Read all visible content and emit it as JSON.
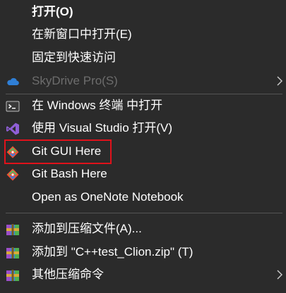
{
  "menu": {
    "items": [
      {
        "label": "打开(O)"
      },
      {
        "label": "在新窗口中打开(E)"
      },
      {
        "label": "固定到快速访问"
      },
      {
        "label": "SkyDrive Pro(S)",
        "icon": "cloud-icon",
        "disabled": true,
        "submenu": true
      },
      {
        "label": "在 Windows 终端 中打开",
        "icon": "terminal-icon"
      },
      {
        "label": "使用 Visual Studio 打开(V)",
        "icon": "visual-studio-icon"
      },
      {
        "label": "Git GUI Here",
        "icon": "git-icon",
        "highlighted": true
      },
      {
        "label": "Git Bash Here",
        "icon": "git-icon"
      },
      {
        "label": "Open as OneNote Notebook"
      },
      {
        "label": "添加到压缩文件(A)...",
        "icon": "archive-icon"
      },
      {
        "label": "添加到 \"C++test_Clion.zip\" (T)",
        "icon": "archive-icon"
      },
      {
        "label": "其他压缩命令",
        "icon": "archive-icon",
        "submenu": true
      }
    ]
  },
  "colors": {
    "background": "#2b2b2b",
    "text": "#ffffff",
    "disabled_text": "#6d6d6d",
    "separator": "#555555",
    "highlight_border": "#e0121b",
    "git_orange": "#f05033",
    "cloud_blue": "#2f7fd6",
    "vs_purple": "#8f5fd6"
  }
}
